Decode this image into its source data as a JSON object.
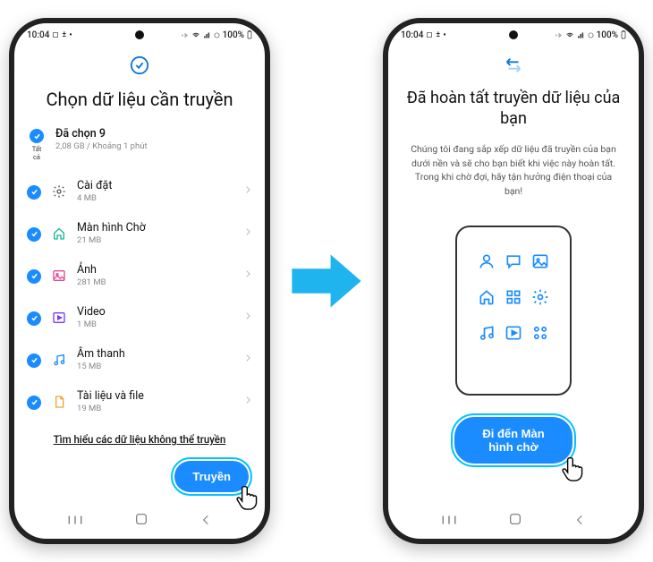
{
  "status": {
    "time": "10:04",
    "battery": "100%"
  },
  "left": {
    "title": "Chọn dữ liệu cần truyền",
    "select_all_label": "Tất cả",
    "selected_title": "Đã chọn 9",
    "selected_sub": "2,08 GB / Khoảng 1 phút",
    "items": [
      {
        "name": "Cài đặt",
        "sub": "4 MB",
        "icon": "gear"
      },
      {
        "name": "Màn hình Chờ",
        "sub": "21 MB",
        "icon": "home"
      },
      {
        "name": "Ảnh",
        "sub": "281 MB",
        "icon": "image"
      },
      {
        "name": "Video",
        "sub": "1 MB",
        "icon": "play"
      },
      {
        "name": "Âm thanh",
        "sub": "15 MB",
        "icon": "music"
      },
      {
        "name": "Tài liệu và file",
        "sub": "19 MB",
        "icon": "document"
      }
    ],
    "link": "Tìm hiểu các dữ liệu không thể truyền",
    "button": "Truyền"
  },
  "right": {
    "title": "Đã hoàn tất truyền dữ liệu của bạn",
    "desc": "Chúng tôi đang sắp xếp dữ liệu đã truyền của bạn dưới nền và sẽ cho bạn biết khi việc này hoàn tất. Trong khi chờ đợi, hãy tận hưởng điện thoại của bạn!",
    "button": "Đi đến Màn hình chờ"
  }
}
